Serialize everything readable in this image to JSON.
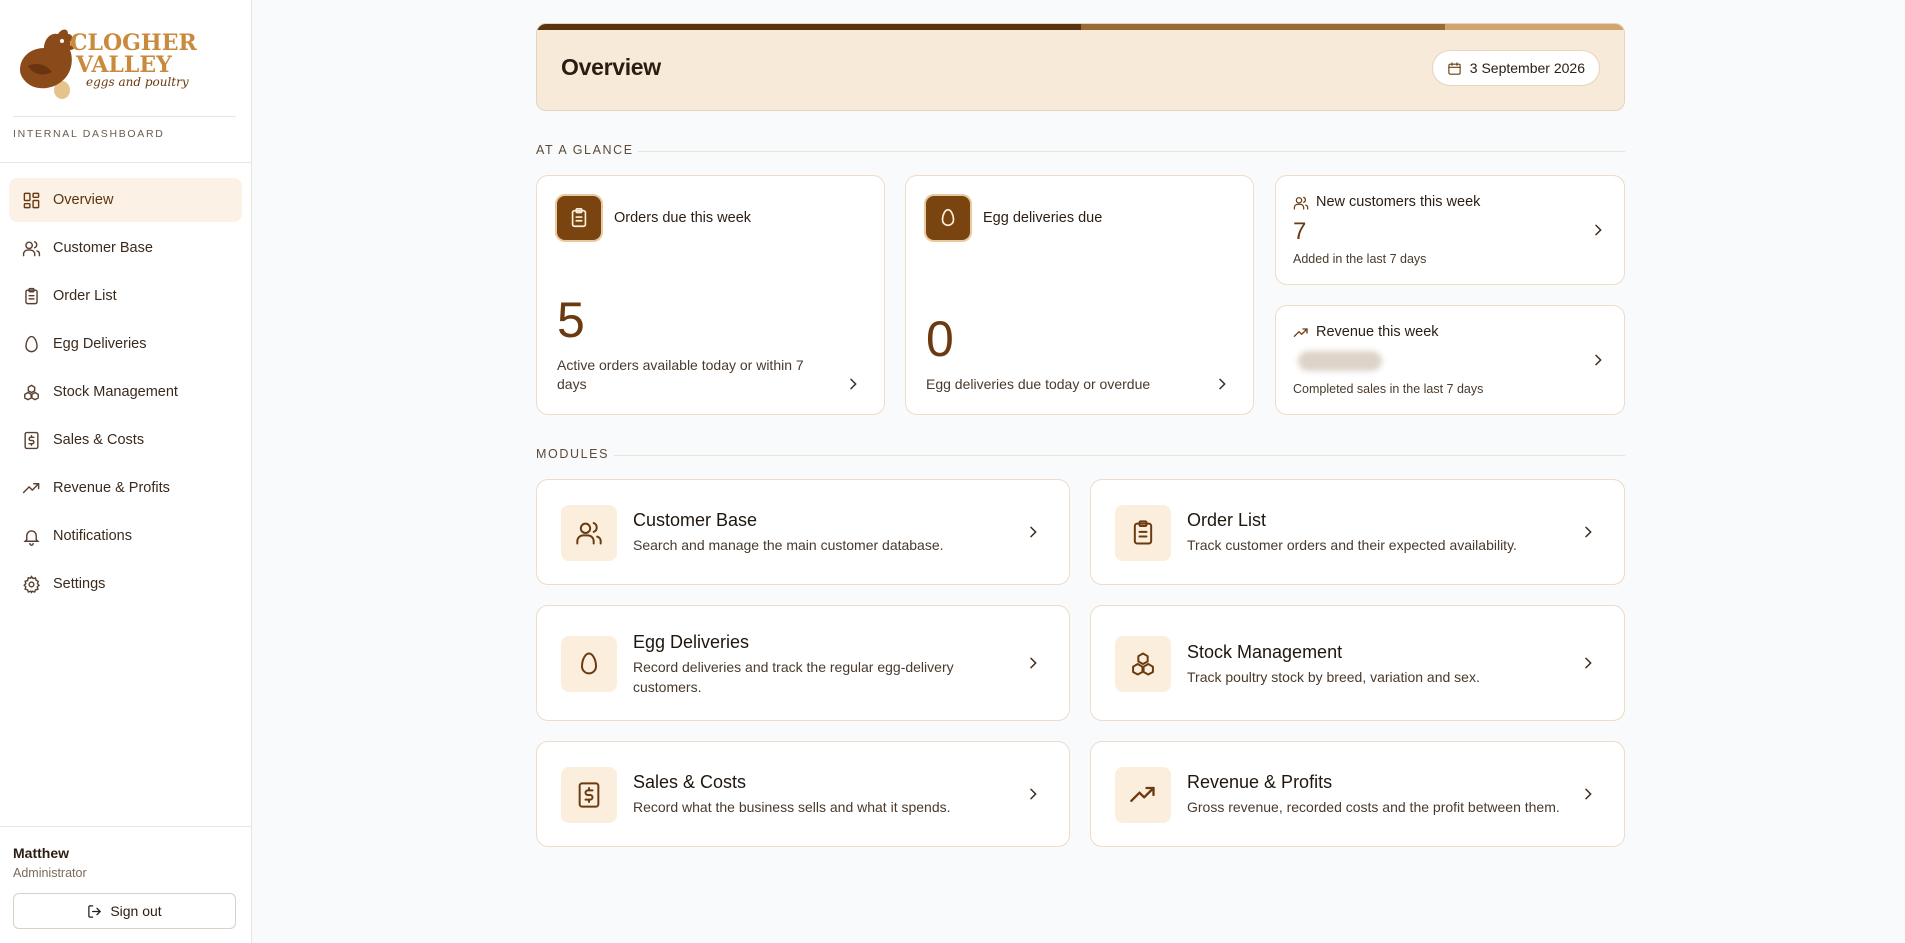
{
  "brand": {
    "logo_line1": "CLOGHER",
    "logo_line2": "VALLEY",
    "logo_tagline": "eggs and poultry",
    "subtitle": "INTERNAL DASHBOARD"
  },
  "sidebar": {
    "items": [
      {
        "label": "Overview",
        "icon": "grid-icon",
        "active": true
      },
      {
        "label": "Customer Base",
        "icon": "users-icon"
      },
      {
        "label": "Order List",
        "icon": "clipboard-icon"
      },
      {
        "label": "Egg Deliveries",
        "icon": "egg-icon"
      },
      {
        "label": "Stock Management",
        "icon": "boxes-icon"
      },
      {
        "label": "Sales & Costs",
        "icon": "receipt-dollar-icon"
      },
      {
        "label": "Revenue & Profits",
        "icon": "trending-up-icon"
      },
      {
        "label": "Notifications",
        "icon": "bell-icon"
      },
      {
        "label": "Settings",
        "icon": "gear-icon"
      }
    ]
  },
  "user": {
    "name": "Matthew",
    "role": "Administrator",
    "signout_label": "Sign out"
  },
  "header": {
    "title": "Overview",
    "date": "3 September 2026"
  },
  "glance": {
    "section_label": "AT A GLANCE",
    "orders": {
      "title": "Orders due this week",
      "value": "5",
      "subtitle": "Active orders available today or within 7 days"
    },
    "deliveries": {
      "title": "Egg deliveries due",
      "value": "0",
      "subtitle": "Egg deliveries due today or overdue"
    },
    "new_customers": {
      "title": "New customers this week",
      "value": "7",
      "subtitle": "Added in the last 7 days"
    },
    "revenue": {
      "title": "Revenue this week",
      "value_hidden": true,
      "subtitle": "Completed sales in the last 7 days"
    }
  },
  "modules": {
    "section_label": "MODULES",
    "items": [
      {
        "title": "Customer Base",
        "desc": "Search and manage the main customer database.",
        "icon": "users-icon"
      },
      {
        "title": "Order List",
        "desc": "Track customer orders and their expected availability.",
        "icon": "clipboard-icon"
      },
      {
        "title": "Egg Deliveries",
        "desc": "Record deliveries and track the regular egg-delivery customers.",
        "icon": "egg-icon"
      },
      {
        "title": "Stock Management",
        "desc": "Track poultry stock by breed, variation and sex.",
        "icon": "boxes-icon"
      },
      {
        "title": "Sales & Costs",
        "desc": "Record what the business sells and what it spends.",
        "icon": "receipt-dollar-icon"
      },
      {
        "title": "Revenue & Profits",
        "desc": "Gross revenue, recorded costs and the profit between them.",
        "icon": "trending-up-icon"
      }
    ]
  },
  "colors": {
    "accent_dark": "#5a3410",
    "accent_mid": "#9a6a35",
    "accent_light": "#d2a56e",
    "header_bg": "#f8ead8",
    "active_nav_bg": "#fbf1e4"
  }
}
